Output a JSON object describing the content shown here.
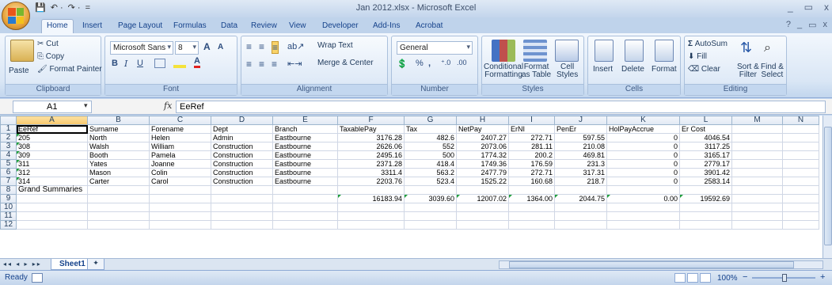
{
  "window": {
    "title": "Jan 2012.xlsx - Microsoft Excel",
    "controls": [
      "_",
      "▭",
      "x"
    ]
  },
  "qat": [
    "💾",
    "↶ ·",
    "↷ ·",
    "="
  ],
  "tabs": [
    "Home",
    "Insert",
    "Page Layout",
    "Formulas",
    "Data",
    "Review",
    "View",
    "Developer",
    "Add-Ins",
    "Acrobat"
  ],
  "help_controls": [
    "?",
    "_",
    "▭",
    "x"
  ],
  "ribbon": {
    "clipboard": {
      "paste": "Paste",
      "cut": "Cut",
      "copy": "Copy",
      "format_painter": "Format Painter",
      "label": "Clipboard"
    },
    "font": {
      "name": "Microsoft Sans",
      "size": "8",
      "grow": "A",
      "shrink": "A",
      "bold": "B",
      "italic": "I",
      "underline": "U",
      "font_color": "A",
      "label": "Font"
    },
    "alignment": {
      "wrap": "Wrap Text",
      "merge": "Merge & Center",
      "label": "Alignment"
    },
    "number": {
      "format": "General",
      "percent": "%",
      "comma": ",",
      "label": "Number"
    },
    "styles": {
      "conditional": "Conditional Formatting",
      "conditional_line1": "Conditional",
      "conditional_line2": "Formatting",
      "format_table": "Format as Table",
      "format_line1": "Format",
      "format_line2": "as Table",
      "cell_styles_line1": "Cell",
      "cell_styles_line2": "Styles",
      "label": "Styles"
    },
    "cells": {
      "insert": "Insert",
      "delete": "Delete",
      "format": "Format",
      "label": "Cells"
    },
    "editing": {
      "autosum": "AutoSum",
      "fill": "Fill",
      "clear": "Clear",
      "sort_line1": "Sort &",
      "sort_line2": "Filter",
      "find_line1": "Find &",
      "find_line2": "Select",
      "label": "Editing"
    }
  },
  "formula_bar": {
    "name_box": "A1",
    "fx": "fx",
    "formula": "EeRef"
  },
  "sheet": {
    "columns": [
      "A",
      "B",
      "C",
      "D",
      "E",
      "F",
      "G",
      "H",
      "I",
      "J",
      "K",
      "L",
      "M",
      "N"
    ],
    "header_row": [
      "EeRef",
      "Surname",
      "Forename",
      "Dept",
      "Branch",
      "TaxablePay",
      "Tax",
      "NetPay",
      "ErNI",
      "PenEr",
      "HolPayAccrue",
      "Er Cost",
      "",
      ""
    ],
    "rows": [
      [
        "205",
        "North",
        "Helen",
        "Admin",
        "Eastbourne",
        "3176.28",
        "482.6",
        "2407.27",
        "272.71",
        "597.55",
        "0",
        "4046.54",
        "",
        ""
      ],
      [
        "308",
        "Walsh",
        "William",
        "Construction",
        "Eastbourne",
        "2626.06",
        "552",
        "2073.06",
        "281.11",
        "210.08",
        "0",
        "3117.25",
        "",
        ""
      ],
      [
        "309",
        "Booth",
        "Pamela",
        "Construction",
        "Eastbourne",
        "2495.16",
        "500",
        "1774.32",
        "200.2",
        "469.81",
        "0",
        "3165.17",
        "",
        ""
      ],
      [
        "311",
        "Yates",
        "Joanne",
        "Construction",
        "Eastbourne",
        "2371.28",
        "418.4",
        "1749.36",
        "176.59",
        "231.3",
        "0",
        "2779.17",
        "",
        ""
      ],
      [
        "312",
        "Mason",
        "Colin",
        "Construction",
        "Eastbourne",
        "3311.4",
        "563.2",
        "2477.79",
        "272.71",
        "317.31",
        "0",
        "3901.42",
        "",
        ""
      ],
      [
        "314",
        "Carter",
        "Carol",
        "Construction",
        "Eastbourne",
        "2203.76",
        "523.4",
        "1525.22",
        "160.68",
        "218.7",
        "0",
        "2583.14",
        "",
        ""
      ]
    ],
    "grand_summaries_label": "Grand Summaries",
    "totals": [
      "",
      "",
      "",
      "",
      "",
      "16183.94",
      "3039.60",
      "12007.02",
      "1364.00",
      "2044.75",
      "0.00",
      "19592.69",
      "",
      ""
    ],
    "row_numbers": [
      "1",
      "2",
      "3",
      "4",
      "5",
      "6",
      "7",
      "8",
      "9",
      "10",
      "11",
      "12"
    ]
  },
  "sheet_tabs": {
    "active": "Sheet1",
    "nav": "◂◂ ◂ ▸ ▸▸"
  },
  "status": {
    "ready": "Ready",
    "zoom": "100%",
    "minus": "−",
    "plus": "+"
  }
}
